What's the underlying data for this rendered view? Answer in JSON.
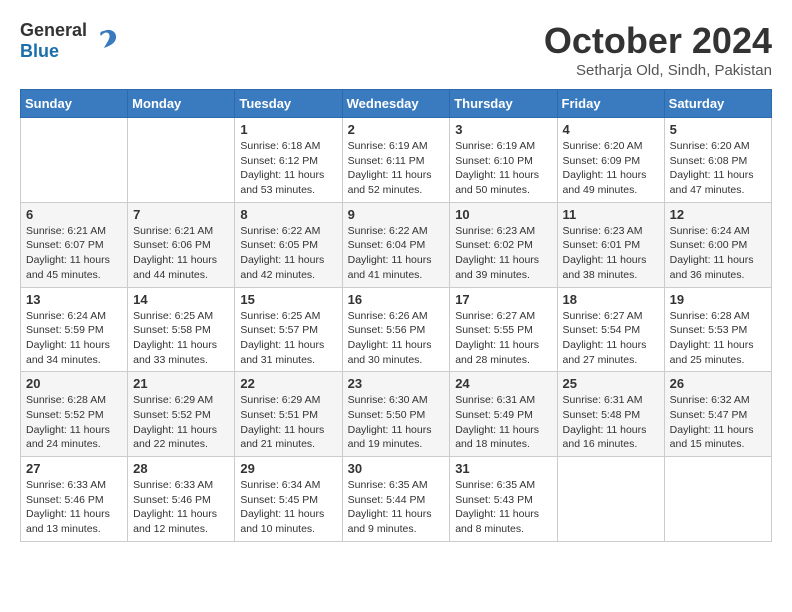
{
  "logo": {
    "general": "General",
    "blue": "Blue"
  },
  "title": "October 2024",
  "location": "Setharja Old, Sindh, Pakistan",
  "weekdays": [
    "Sunday",
    "Monday",
    "Tuesday",
    "Wednesday",
    "Thursday",
    "Friday",
    "Saturday"
  ],
  "weeks": [
    [
      {
        "day": "",
        "info": ""
      },
      {
        "day": "",
        "info": ""
      },
      {
        "day": "1",
        "info": "Sunrise: 6:18 AM\nSunset: 6:12 PM\nDaylight: 11 hours and 53 minutes."
      },
      {
        "day": "2",
        "info": "Sunrise: 6:19 AM\nSunset: 6:11 PM\nDaylight: 11 hours and 52 minutes."
      },
      {
        "day": "3",
        "info": "Sunrise: 6:19 AM\nSunset: 6:10 PM\nDaylight: 11 hours and 50 minutes."
      },
      {
        "day": "4",
        "info": "Sunrise: 6:20 AM\nSunset: 6:09 PM\nDaylight: 11 hours and 49 minutes."
      },
      {
        "day": "5",
        "info": "Sunrise: 6:20 AM\nSunset: 6:08 PM\nDaylight: 11 hours and 47 minutes."
      }
    ],
    [
      {
        "day": "6",
        "info": "Sunrise: 6:21 AM\nSunset: 6:07 PM\nDaylight: 11 hours and 45 minutes."
      },
      {
        "day": "7",
        "info": "Sunrise: 6:21 AM\nSunset: 6:06 PM\nDaylight: 11 hours and 44 minutes."
      },
      {
        "day": "8",
        "info": "Sunrise: 6:22 AM\nSunset: 6:05 PM\nDaylight: 11 hours and 42 minutes."
      },
      {
        "day": "9",
        "info": "Sunrise: 6:22 AM\nSunset: 6:04 PM\nDaylight: 11 hours and 41 minutes."
      },
      {
        "day": "10",
        "info": "Sunrise: 6:23 AM\nSunset: 6:02 PM\nDaylight: 11 hours and 39 minutes."
      },
      {
        "day": "11",
        "info": "Sunrise: 6:23 AM\nSunset: 6:01 PM\nDaylight: 11 hours and 38 minutes."
      },
      {
        "day": "12",
        "info": "Sunrise: 6:24 AM\nSunset: 6:00 PM\nDaylight: 11 hours and 36 minutes."
      }
    ],
    [
      {
        "day": "13",
        "info": "Sunrise: 6:24 AM\nSunset: 5:59 PM\nDaylight: 11 hours and 34 minutes."
      },
      {
        "day": "14",
        "info": "Sunrise: 6:25 AM\nSunset: 5:58 PM\nDaylight: 11 hours and 33 minutes."
      },
      {
        "day": "15",
        "info": "Sunrise: 6:25 AM\nSunset: 5:57 PM\nDaylight: 11 hours and 31 minutes."
      },
      {
        "day": "16",
        "info": "Sunrise: 6:26 AM\nSunset: 5:56 PM\nDaylight: 11 hours and 30 minutes."
      },
      {
        "day": "17",
        "info": "Sunrise: 6:27 AM\nSunset: 5:55 PM\nDaylight: 11 hours and 28 minutes."
      },
      {
        "day": "18",
        "info": "Sunrise: 6:27 AM\nSunset: 5:54 PM\nDaylight: 11 hours and 27 minutes."
      },
      {
        "day": "19",
        "info": "Sunrise: 6:28 AM\nSunset: 5:53 PM\nDaylight: 11 hours and 25 minutes."
      }
    ],
    [
      {
        "day": "20",
        "info": "Sunrise: 6:28 AM\nSunset: 5:52 PM\nDaylight: 11 hours and 24 minutes."
      },
      {
        "day": "21",
        "info": "Sunrise: 6:29 AM\nSunset: 5:52 PM\nDaylight: 11 hours and 22 minutes."
      },
      {
        "day": "22",
        "info": "Sunrise: 6:29 AM\nSunset: 5:51 PM\nDaylight: 11 hours and 21 minutes."
      },
      {
        "day": "23",
        "info": "Sunrise: 6:30 AM\nSunset: 5:50 PM\nDaylight: 11 hours and 19 minutes."
      },
      {
        "day": "24",
        "info": "Sunrise: 6:31 AM\nSunset: 5:49 PM\nDaylight: 11 hours and 18 minutes."
      },
      {
        "day": "25",
        "info": "Sunrise: 6:31 AM\nSunset: 5:48 PM\nDaylight: 11 hours and 16 minutes."
      },
      {
        "day": "26",
        "info": "Sunrise: 6:32 AM\nSunset: 5:47 PM\nDaylight: 11 hours and 15 minutes."
      }
    ],
    [
      {
        "day": "27",
        "info": "Sunrise: 6:33 AM\nSunset: 5:46 PM\nDaylight: 11 hours and 13 minutes."
      },
      {
        "day": "28",
        "info": "Sunrise: 6:33 AM\nSunset: 5:46 PM\nDaylight: 11 hours and 12 minutes."
      },
      {
        "day": "29",
        "info": "Sunrise: 6:34 AM\nSunset: 5:45 PM\nDaylight: 11 hours and 10 minutes."
      },
      {
        "day": "30",
        "info": "Sunrise: 6:35 AM\nSunset: 5:44 PM\nDaylight: 11 hours and 9 minutes."
      },
      {
        "day": "31",
        "info": "Sunrise: 6:35 AM\nSunset: 5:43 PM\nDaylight: 11 hours and 8 minutes."
      },
      {
        "day": "",
        "info": ""
      },
      {
        "day": "",
        "info": ""
      }
    ]
  ]
}
